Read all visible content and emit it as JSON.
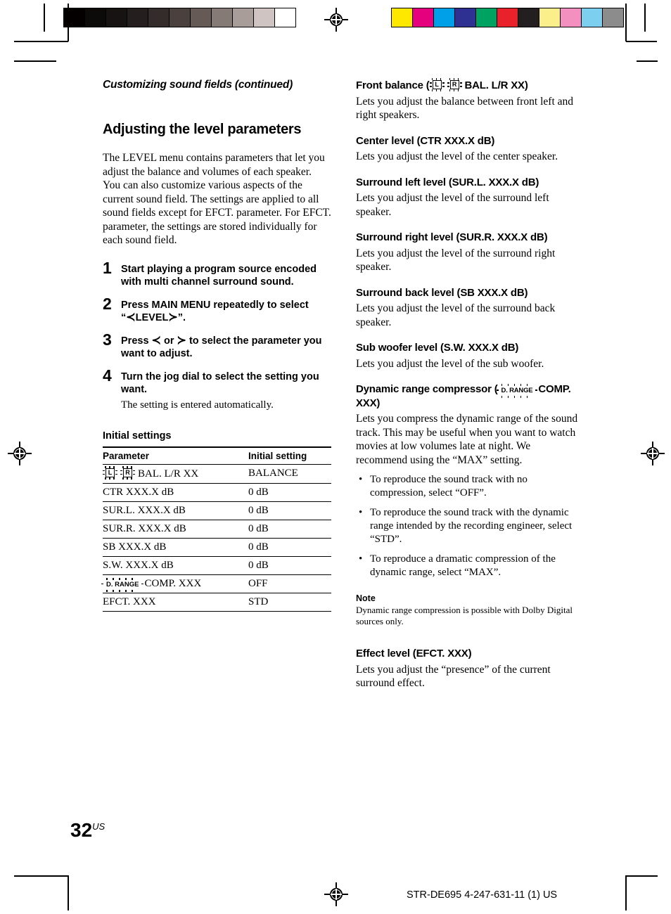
{
  "document": {
    "running_head": "Customizing sound fields (continued)",
    "page_number": "32",
    "page_region": "US",
    "footer_model": "STR-DE695 4-247-631-11 (1) US"
  },
  "calibration": {
    "gray_bar_label": "grayscale-calibration-bar",
    "gray_patches": [
      "#040000",
      "#0d0a0a",
      "#171313",
      "#241e1e",
      "#332c2a",
      "#4a413e",
      "#665a57",
      "#867a76",
      "#a89d99",
      "#cfc4c1",
      "#ffffff"
    ],
    "color_bar_label": "color-calibration-bar",
    "color_patches": [
      "#ffe800",
      "#e5007e",
      "#00a0e9",
      "#2e3192",
      "#00a261",
      "#e8212a",
      "#231f20",
      "#fbef8c",
      "#f490c0",
      "#7dcff0",
      "#8c8c8c"
    ]
  },
  "left_column": {
    "section_title": "Adjusting the level parameters",
    "intro": "The LEVEL menu contains parameters that let you adjust the balance and volumes of each speaker. You can also customize various aspects of the current sound field. The settings are applied to all sound fields except for EFCT. parameter. For EFCT. parameter, the settings are stored individually for each sound field.",
    "steps": [
      {
        "number": "1",
        "text": "Start playing a program source encoded with multi channel surround sound.",
        "note": ""
      },
      {
        "number": "2",
        "text_before": "Press MAIN MENU repeatedly to select “",
        "angle_open": "≺",
        "label": "LEVEL",
        "angle_close": "≻",
        "text_after": "”.",
        "note": ""
      },
      {
        "number": "3",
        "text_before": "Press ",
        "angle_open": "≺",
        "middle": " or ",
        "angle_close": "≻",
        "text_after": " to select the parameter you want to adjust.",
        "note": ""
      },
      {
        "number": "4",
        "text": "Turn the jog dial to select the setting you want.",
        "note": "The setting is entered automatically."
      }
    ],
    "table": {
      "title": "Initial settings",
      "headers": [
        "Parameter",
        "Initial setting"
      ],
      "rows": [
        {
          "icon": "bal-lr-indicator",
          "icon_left": "L",
          "icon_right": "R",
          "parameter": "BAL. L/R XX",
          "setting": "BALANCE"
        },
        {
          "icon": "",
          "parameter": "CTR XXX.X dB",
          "setting": "0 dB"
        },
        {
          "icon": "",
          "parameter": "SUR.L. XXX.X dB",
          "setting": "0 dB"
        },
        {
          "icon": "",
          "parameter": "SUR.R. XXX.X dB",
          "setting": "0 dB"
        },
        {
          "icon": "",
          "parameter": "SB XXX.X dB",
          "setting": "0 dB"
        },
        {
          "icon": "",
          "parameter": "S.W. XXX.X dB",
          "setting": "0 dB"
        },
        {
          "icon": "d-range-indicator",
          "icon_label": "D. RANGE",
          "parameter": "COMP. XXX",
          "setting": "OFF"
        },
        {
          "icon": "",
          "parameter": "EFCT. XXX",
          "setting": "STD"
        }
      ]
    }
  },
  "right_column": {
    "front_balance": {
      "heading_before": "Front balance (",
      "icon_left": "L",
      "icon_right": "R",
      "heading_after": "BAL. L/R XX)",
      "body": "Lets you adjust the balance between front left and right speakers."
    },
    "center_level": {
      "heading": "Center level (CTR XXX.X dB)",
      "body": "Lets you adjust the level of the center speaker."
    },
    "surround_left_level": {
      "heading": "Surround left level (SUR.L. XXX.X dB)",
      "body": "Lets you adjust the level of the surround left speaker."
    },
    "surround_right_level": {
      "heading": "Surround right level (SUR.R. XXX.X dB)",
      "body": "Lets you adjust the level of the surround right speaker."
    },
    "surround_back_level": {
      "heading": "Surround back level (SB XXX.X dB)",
      "body": "Lets you adjust the level of the surround back speaker."
    },
    "sub_woofer_level": {
      "heading": "Sub woofer level (S.W. XXX.X dB)",
      "body": "Lets you adjust the level of the sub woofer."
    },
    "dynamic_range": {
      "heading_before": "Dynamic range compressor (",
      "icon_label": "D. RANGE",
      "heading_after": "COMP. XXX)",
      "body": "Lets you compress the dynamic range of the sound track. This may be useful when you want to watch movies at low volumes late at night. We recommend using the “MAX” setting.",
      "bullets": [
        "To reproduce the sound track with no compression, select “OFF”.",
        "To reproduce the sound track with the dynamic range intended by the recording engineer, select “STD”.",
        "To reproduce a dramatic compression of the dynamic range, select “MAX”."
      ],
      "note_title": "Note",
      "note_body": "Dynamic range compression is possible with Dolby Digital sources only."
    },
    "effect_level": {
      "heading": "Effect level (EFCT. XXX)",
      "body": "Lets you adjust the “presence” of the current surround effect."
    }
  }
}
